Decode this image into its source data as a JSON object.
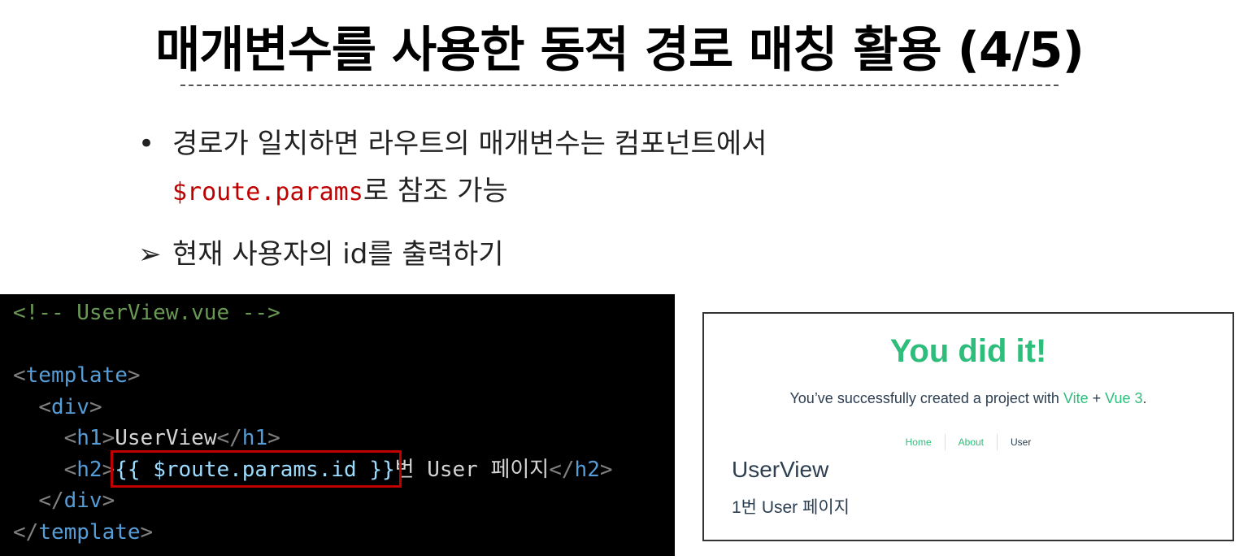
{
  "slide": {
    "title": "매개변수를 사용한 동적 경로 매칭 활용 (4/5)",
    "bullet1_mark": "•",
    "bullet1_line1": "경로가 일치하면 라우트의 매개변수는 컴포넌트에서",
    "bullet1_code": "$route.params",
    "bullet1_line2_rest": "로 참조 가능",
    "bullet2_mark": "➢",
    "bullet2_text": "현재 사용자의 id를 출력하기"
  },
  "code": {
    "comment": "<!-- UserView.vue -->",
    "template_open": "template",
    "div_open": "div",
    "h1_tag": "h1",
    "h1_text": "UserView",
    "h2_tag": "h2",
    "h2_expr": "{{ $route.params.id }}",
    "h2_text": "번 User 페이지",
    "div_close": "div",
    "template_close": "template"
  },
  "preview": {
    "heading": "You did it!",
    "sub_before": "You’ve successfully created a project with ",
    "sub_link1": "Vite",
    "sub_mid": " + ",
    "sub_link2": "Vue 3",
    "sub_after": ".",
    "nav": [
      "Home",
      "About",
      "User"
    ],
    "h1": "UserView",
    "h2": "1번 User 페이지"
  },
  "colors": {
    "code_highlight": "#c00000",
    "vue_green": "#2ebd7b"
  }
}
